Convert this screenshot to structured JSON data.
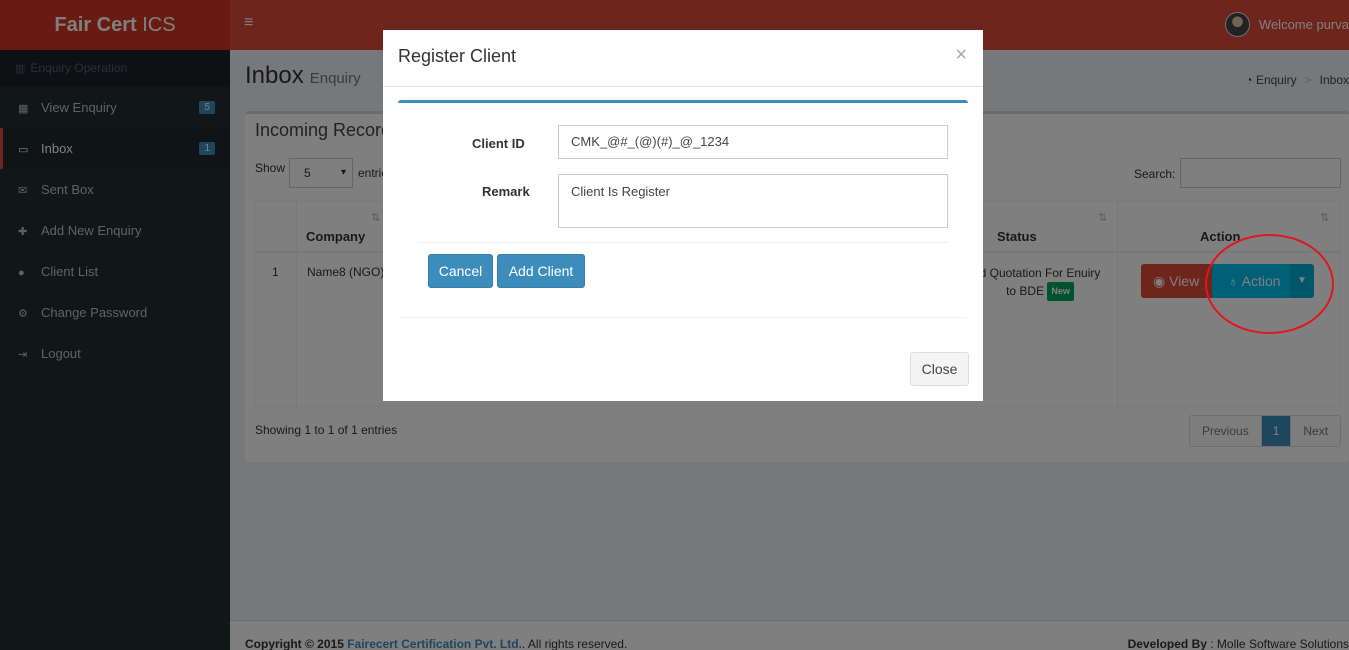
{
  "app": {
    "logo_bold": "Fair Cert",
    "logo_rest": " ICS",
    "welcome": "Welcome purva"
  },
  "sidebar": {
    "header": "Enquiry Operation",
    "items": [
      {
        "label": "View Enquiry",
        "badge": "5"
      },
      {
        "label": "Inbox",
        "badge": "1"
      },
      {
        "label": "Sent Box"
      },
      {
        "label": "Add New Enquiry"
      },
      {
        "label": "Client List"
      },
      {
        "label": "Change Password"
      },
      {
        "label": "Logout"
      }
    ]
  },
  "content": {
    "title": "Inbox",
    "subtitle": "Enquiry",
    "breadcrumb": [
      "Enquiry",
      "Inbox"
    ]
  },
  "box": {
    "title": "Incoming Records",
    "show_label": "Show",
    "entries_value": "5",
    "entries_label": "entries",
    "search_label": "Search:",
    "columns": {
      "company": "Company",
      "status": "Status",
      "action": "Action"
    },
    "row": {
      "index": "1",
      "company": "Name8 (NGO)",
      "status_text": "Send Quotation For Enuiry to BDE",
      "status_line1": "d Quotation For Enuiry",
      "status_line2": "to BDE",
      "status_badge": "New"
    },
    "view_label": "View",
    "action_label": "Action",
    "info": "Showing 1 to 1 of 1 entries",
    "pager": {
      "previous": "Previous",
      "current": "1",
      "next": "Next"
    }
  },
  "footer": {
    "copyright": "Copyright © 2015",
    "company": "Fairecert Certification Pvt. Ltd.",
    "rights": ". All rights reserved.",
    "developed_label": "Developed By",
    "developed_by": ": Molle Software Solutions"
  },
  "modal": {
    "title": "Register Client",
    "client_id_label": "Client ID",
    "client_id_value": "CMK_@#_(@)(#)_@_1234",
    "remark_label": "Remark",
    "remark_value": "Client Is Register",
    "cancel_label": "Cancel",
    "add_label": "Add Client",
    "close_label": "Close"
  },
  "colors": {
    "header": "#dd4b39",
    "logo": "#d33724",
    "sidebar": "#222d32",
    "primary": "#3c8dbc",
    "info": "#00c0ef",
    "danger": "#dd4b39",
    "annotation": "#e0171c"
  }
}
